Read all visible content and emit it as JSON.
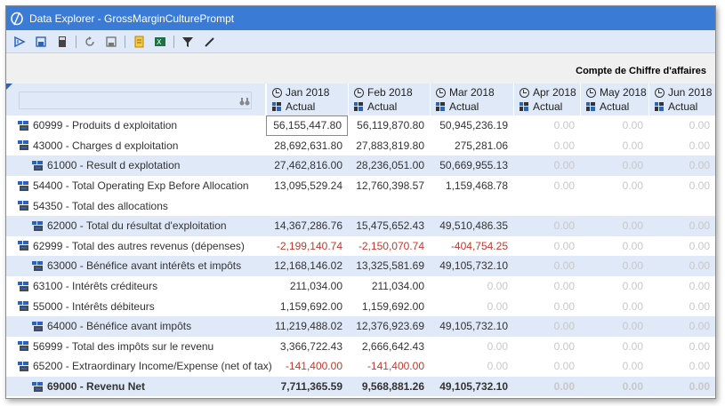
{
  "window": {
    "title": "Data Explorer - GrossMarginCulturePrompt"
  },
  "toolbar": {
    "buttons": [
      "run-icon",
      "save-view-icon",
      "calculator-icon",
      "refresh-icon",
      "save-icon",
      "document-icon",
      "excel-icon",
      "filter-icon",
      "edit-icon"
    ]
  },
  "header": {
    "title": "Compte de Chiffre d'affaires"
  },
  "search": {
    "value": ""
  },
  "columns": [
    {
      "date": "Jan 2018",
      "scenario": "Actual"
    },
    {
      "date": "Feb 2018",
      "scenario": "Actual"
    },
    {
      "date": "Mar 2018",
      "scenario": "Actual"
    },
    {
      "date": "Apr 2018",
      "scenario": "Actual"
    },
    {
      "date": "May 2018",
      "scenario": "Actual"
    },
    {
      "date": "Jun 2018",
      "scenario": "Actual"
    }
  ],
  "rows": [
    {
      "label": "60999 - Produits d exploitation",
      "values": [
        "56,155,447.80",
        "56,119,870.80",
        "50,945,236.19",
        "0.00",
        "0.00",
        "0.00"
      ]
    },
    {
      "label": "43000 - Charges d exploitation",
      "values": [
        "28,692,631.80",
        "27,883,819.80",
        "275,281.06",
        "0.00",
        "0.00",
        "0.00"
      ]
    },
    {
      "label": "61000 - Result d explotation",
      "values": [
        "27,462,816.00",
        "28,236,051.00",
        "50,669,955.13",
        "0.00",
        "0.00",
        "0.00"
      ]
    },
    {
      "label": "54400 - Total Operating Exp Before Allocation",
      "values": [
        "13,095,529.24",
        "12,760,398.57",
        "1,159,468.78",
        "0.00",
        "0.00",
        "0.00"
      ]
    },
    {
      "label": "54350 - Total des allocations",
      "values": [
        "",
        "",
        "",
        "",
        "",
        ""
      ]
    },
    {
      "label": "62000 - Total du résultat d'exploitation",
      "values": [
        "14,367,286.76",
        "15,475,652.43",
        "49,510,486.35",
        "0.00",
        "0.00",
        "0.00"
      ]
    },
    {
      "label": "62999 - Total des autres revenus (dépenses)",
      "values": [
        "-2,199,140.74",
        "-2,150,070.74",
        "-404,754.25",
        "0.00",
        "0.00",
        "0.00"
      ]
    },
    {
      "label": "63000 - Bénéfice avant intérêts et impôts",
      "values": [
        "12,168,146.02",
        "13,325,581.69",
        "49,105,732.10",
        "0.00",
        "0.00",
        "0.00"
      ]
    },
    {
      "label": "63100 - Intérêts créditeurs",
      "values": [
        "211,034.00",
        "211,034.00",
        "0.00",
        "0.00",
        "0.00",
        "0.00"
      ]
    },
    {
      "label": "55000 - Intérêts débiteurs",
      "values": [
        "1,159,692.00",
        "1,159,692.00",
        "0.00",
        "0.00",
        "0.00",
        "0.00"
      ]
    },
    {
      "label": "64000 - Bénéfice avant impôts",
      "values": [
        "11,219,488.02",
        "12,376,923.69",
        "49,105,732.10",
        "0.00",
        "0.00",
        "0.00"
      ]
    },
    {
      "label": "56999 - Total des impôts sur le revenu",
      "values": [
        "3,366,722.43",
        "2,666,642.43",
        "0.00",
        "0.00",
        "0.00",
        "0.00"
      ]
    },
    {
      "label": "65200 - Extraordinary Income/Expense (net of tax)",
      "values": [
        "-141,400.00",
        "-141,400.00",
        "0.00",
        "0.00",
        "0.00",
        "0.00"
      ]
    },
    {
      "label": "69000 - Revenu Net",
      "values": [
        "7,711,365.59",
        "9,568,881.26",
        "49,105,732.10",
        "0.00",
        "0.00",
        "0.00"
      ]
    }
  ]
}
